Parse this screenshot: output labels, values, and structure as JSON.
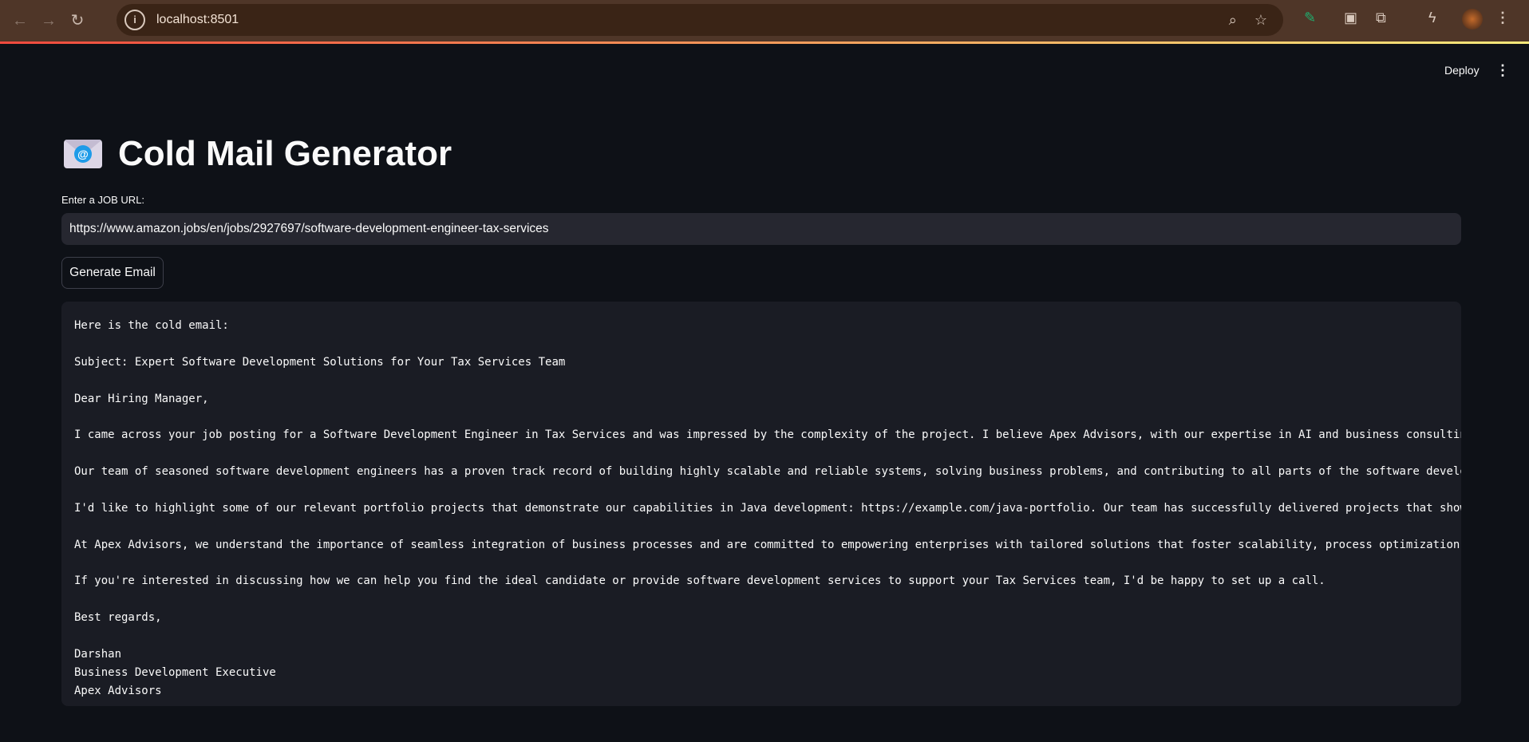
{
  "browser": {
    "url": "localhost:8501"
  },
  "header": {
    "deploy_label": "Deploy",
    "menu_icon": "kebab-icon"
  },
  "app": {
    "title": "Cold Mail Generator",
    "url_label": "Enter a JOB URL:",
    "url_value": "https://www.amazon.jobs/en/jobs/2927697/software-development-engineer-tax-services",
    "generate_label": "Generate Email",
    "email_lines": [
      "Here is the cold email:",
      "",
      "Subject: Expert Software Development Solutions for Your Tax Services Team",
      "",
      "Dear Hiring Manager,",
      "",
      "I came across your job posting for a Software Development Engineer in Tax Services and was impressed by the complexity of the project. I believe Apex Advisors, with our expertise in AI and business consultin",
      "",
      "Our team of seasoned software development engineers has a proven track record of building highly scalable and reliable systems, solving business problems, and contributing to all parts of the software develo",
      "",
      "I'd like to highlight some of our relevant portfolio projects that demonstrate our capabilities in Java development: https://example.com/java-portfolio. Our team has successfully delivered projects that show",
      "",
      "At Apex Advisors, we understand the importance of seamless integration of business processes and are committed to empowering enterprises with tailored solutions that foster scalability, process optimization,",
      "",
      "If you're interested in discussing how we can help you find the ideal candidate or provide software development services to support your Tax Services team, I'd be happy to set up a call.",
      "",
      "Best regards,",
      "",
      "Darshan",
      "Business Development Executive",
      "Apex Advisors"
    ]
  }
}
